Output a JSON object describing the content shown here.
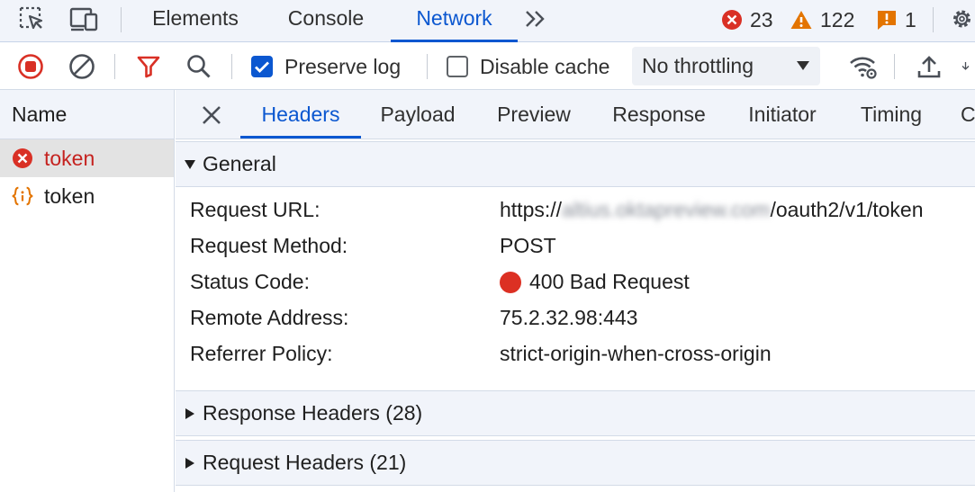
{
  "topbar": {
    "tabs": [
      {
        "label": "Elements"
      },
      {
        "label": "Console"
      },
      {
        "label": "Network"
      }
    ],
    "counters": {
      "errors": "23",
      "warnings": "122",
      "issues": "1"
    }
  },
  "toolbar": {
    "preserve_log_label": "Preserve log",
    "disable_cache_label": "Disable cache",
    "throttling_value": "No throttling"
  },
  "request_list": {
    "header": "Name",
    "items": [
      {
        "name": "token"
      },
      {
        "name": "token"
      }
    ]
  },
  "detail": {
    "tabs": [
      {
        "label": "Headers"
      },
      {
        "label": "Payload"
      },
      {
        "label": "Preview"
      },
      {
        "label": "Response"
      },
      {
        "label": "Initiator"
      },
      {
        "label": "Timing"
      },
      {
        "label": "C"
      }
    ],
    "general": {
      "title": "General",
      "rows": [
        {
          "key": "Request URL:",
          "value_prefix": "https://",
          "value_redacted": "altius.oktapreview.com",
          "value_suffix": "/oauth2/v1/token"
        },
        {
          "key": "Request Method:",
          "value": "POST"
        },
        {
          "key": "Status Code:",
          "value": "400 Bad Request"
        },
        {
          "key": "Remote Address:",
          "value": "75.2.32.98:443"
        },
        {
          "key": "Referrer Policy:",
          "value": "strict-origin-when-cross-origin"
        }
      ]
    },
    "response_headers_title": "Response Headers (28)",
    "request_headers_title": "Request Headers (21)"
  },
  "colors": {
    "accent": "#0b57d0",
    "error": "#d93025",
    "warning": "#e37400",
    "status_dot": "#dc3023"
  }
}
